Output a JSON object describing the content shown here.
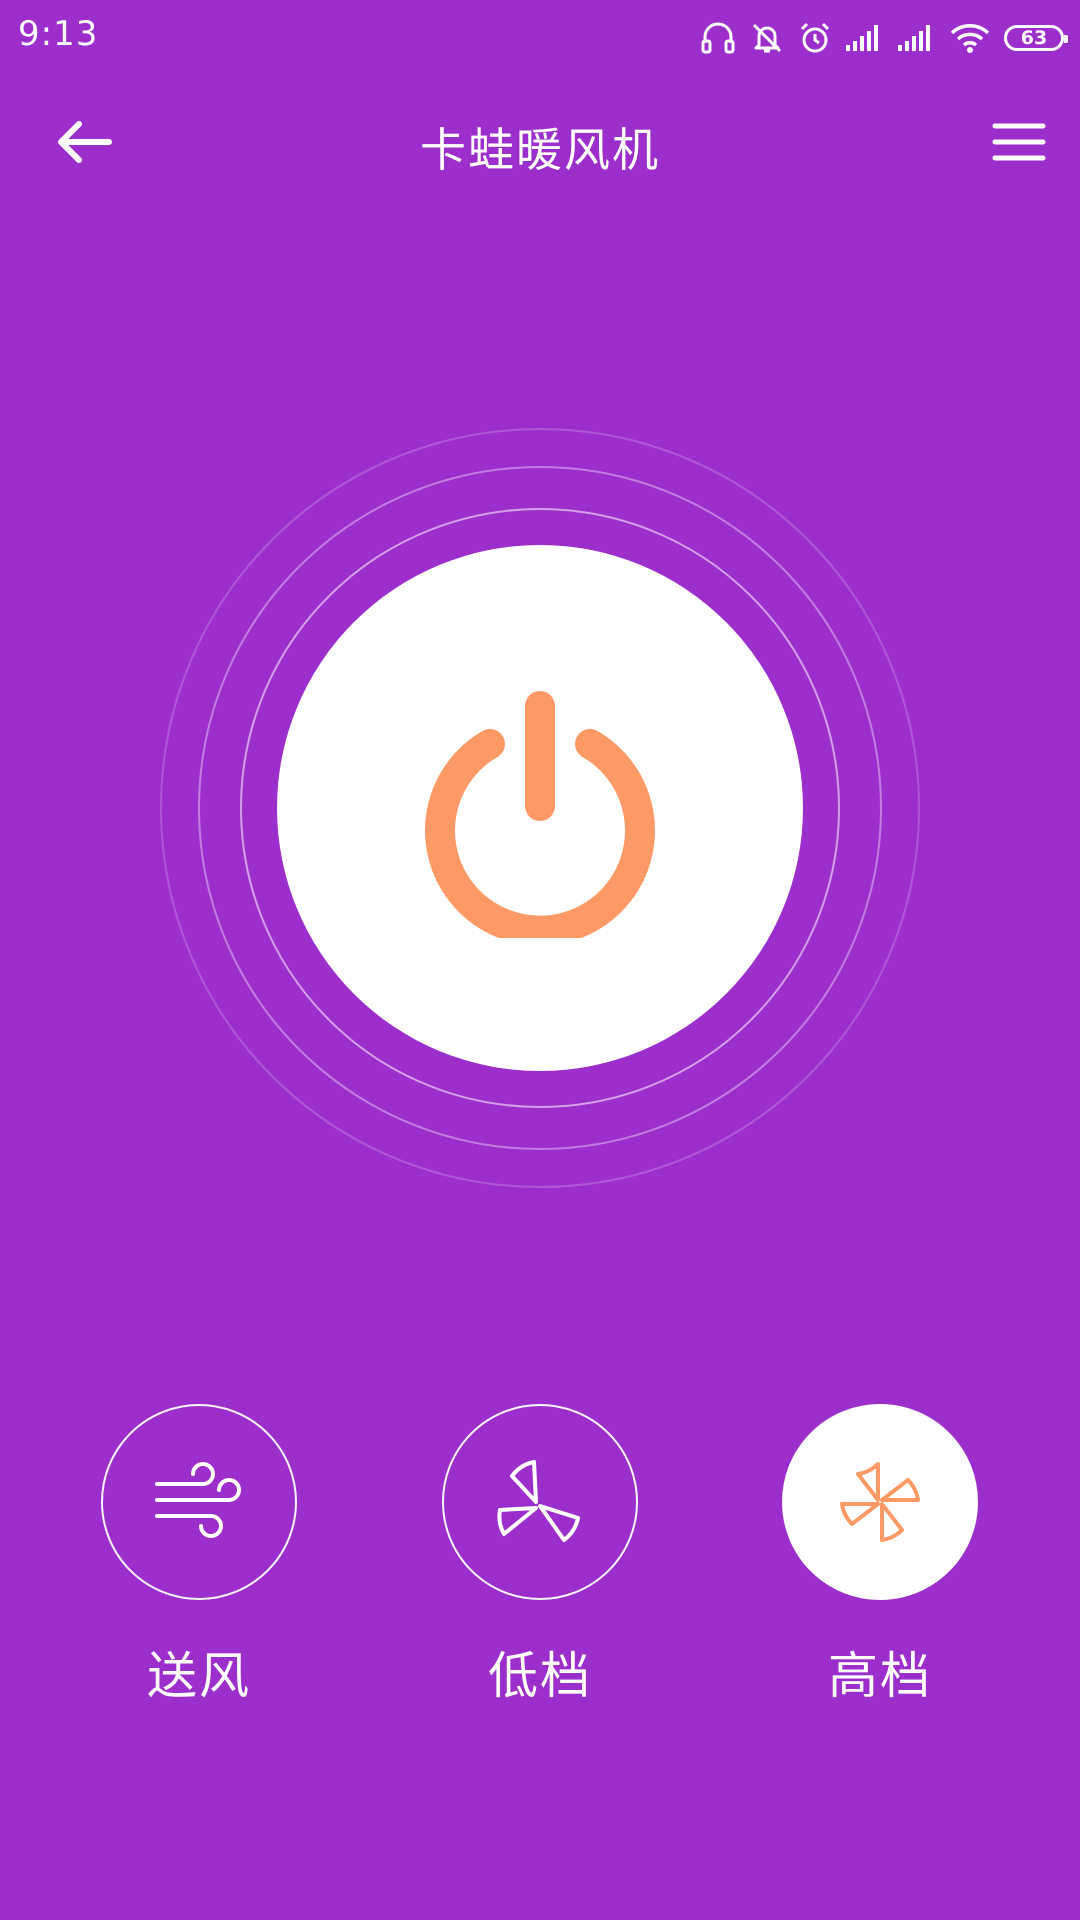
{
  "status_bar": {
    "time": "9:13",
    "battery": "63",
    "icons": [
      "headphones-icon",
      "silent-bell-icon",
      "alarm-icon",
      "signal-icon",
      "signal-icon",
      "wifi-icon",
      "battery-icon"
    ]
  },
  "app_bar": {
    "title": "卡蛙暖风机",
    "back_icon": "back-arrow-icon",
    "menu_icon": "hamburger-menu-icon"
  },
  "power": {
    "icon": "power-icon",
    "icon_color": "#ff9966"
  },
  "modes": [
    {
      "label": "送风",
      "icon": "wind-icon",
      "active": false
    },
    {
      "label": "低档",
      "icon": "fan-low-icon",
      "active": false
    },
    {
      "label": "高档",
      "icon": "fan-high-icon",
      "active": true
    }
  ],
  "colors": {
    "background": "#9c2fcc",
    "accent": "#ff9966",
    "foreground": "#ffffff"
  }
}
